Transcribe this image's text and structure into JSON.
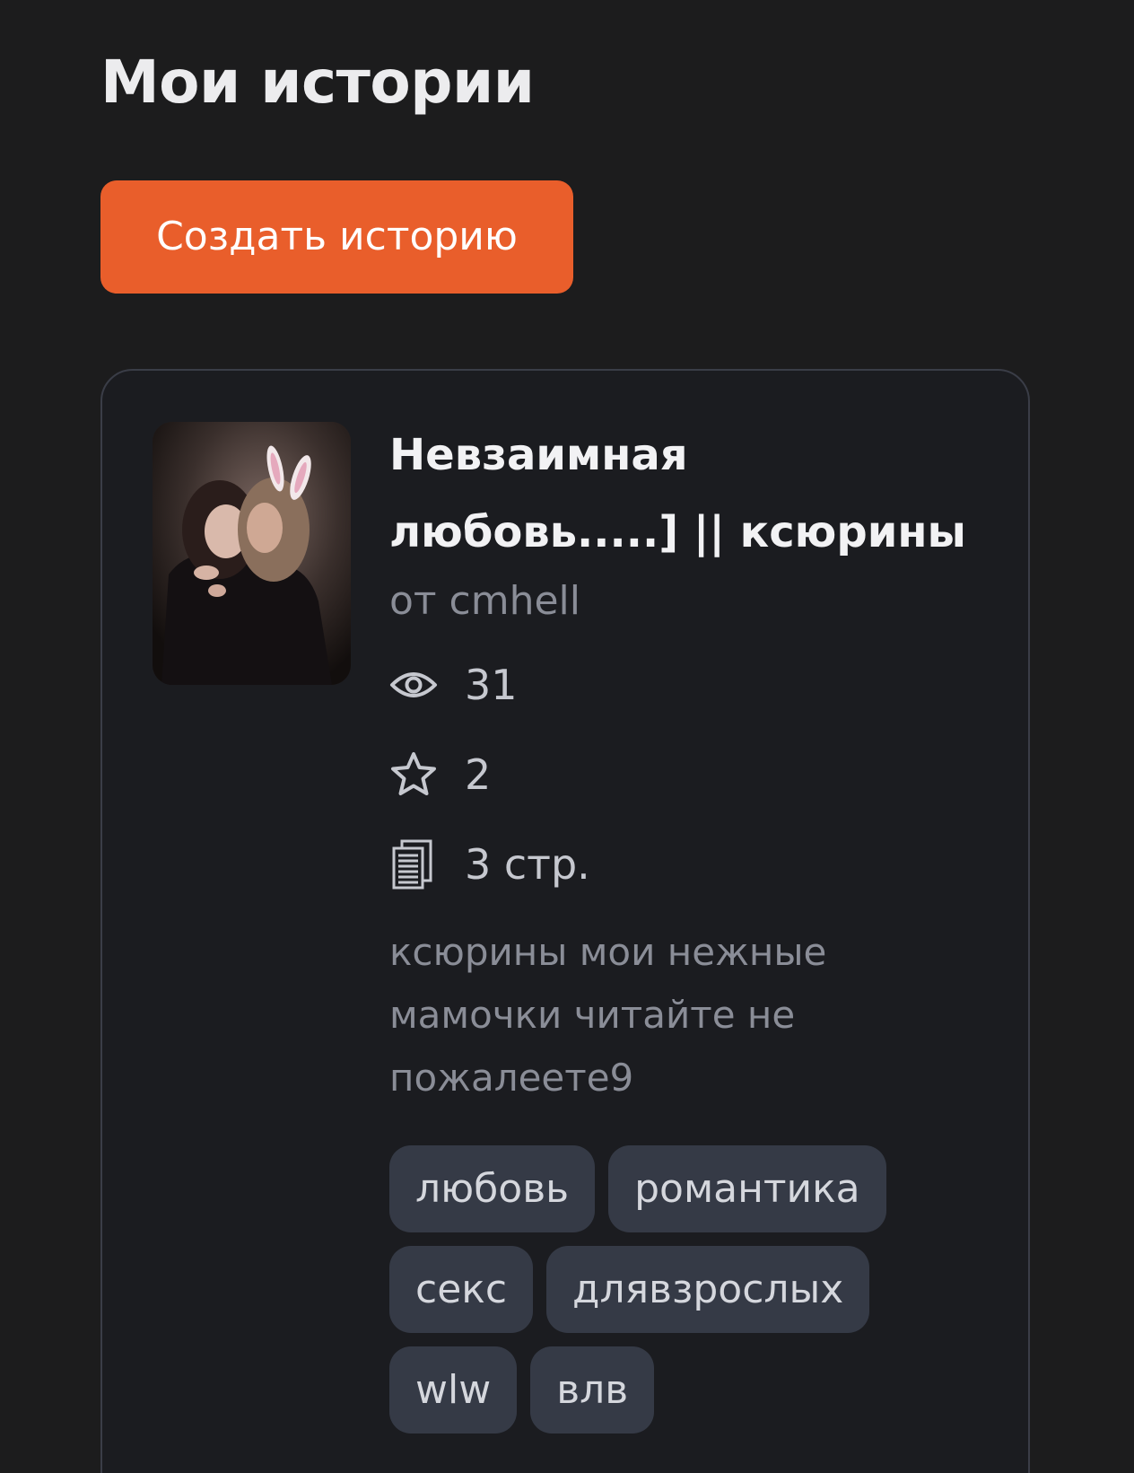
{
  "header": {
    "title": "Мои истории"
  },
  "actions": {
    "create_label": "Создать историю"
  },
  "story": {
    "title": "Невзаимная любовь.....] || ксюрины",
    "author": "от cmhell",
    "views": "31",
    "stars": "2",
    "pages": "3 стр.",
    "description": "ксюрины мои нежные мамочки читайте не пожалеете9",
    "tags": [
      "любовь",
      "романтика",
      "секс",
      "длявзрослых",
      "wlw",
      "влв"
    ]
  },
  "icons": {
    "views": "eye-icon",
    "stars": "star-icon",
    "pages": "pages-icon"
  },
  "colors": {
    "background": "#1c1c1d",
    "accent": "#e95e2b",
    "card": "#1b1c20",
    "tag": "#353a46"
  }
}
